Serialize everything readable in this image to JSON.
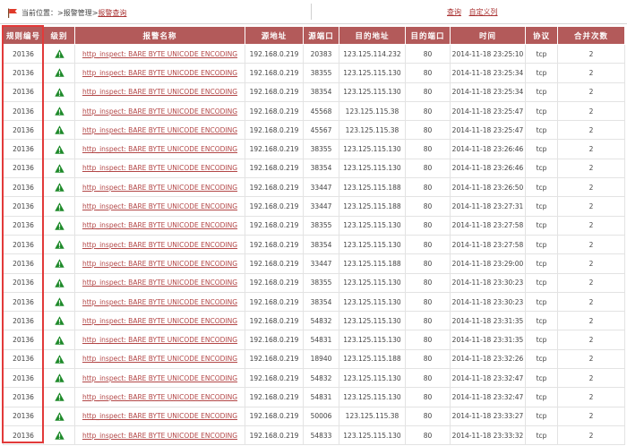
{
  "breadcrumb": {
    "prefix": "当前位置：",
    "sep1": ">",
    "level1": "报警管理",
    "sep2": ">",
    "level2": "报警查询"
  },
  "actions": {
    "query": "查询",
    "custom_columns": "自定义列"
  },
  "colors": {
    "header_bg": "#b35a5a",
    "link": "#b34747",
    "highlight_border": "#e23a3a",
    "warning_icon": "#1e8a2a"
  },
  "table": {
    "columns": [
      "规则编号",
      "级别",
      "报警名称",
      "源地址",
      "源端口",
      "目的地址",
      "目的端口",
      "时间",
      "协议",
      "合并次数"
    ],
    "rows": [
      {
        "rule_id": "20136",
        "level_icon": "warning-icon",
        "name": "http_inspect: BARE BYTE UNICODE ENCODING",
        "src": "192.168.0.219",
        "sport": "20383",
        "dst": "123.125.114.232",
        "dport": "80",
        "time": "2014-11-18 23:25:10",
        "proto": "tcp",
        "count": "2"
      },
      {
        "rule_id": "20136",
        "level_icon": "warning-icon",
        "name": "http_inspect: BARE BYTE UNICODE ENCODING",
        "src": "192.168.0.219",
        "sport": "38355",
        "dst": "123.125.115.130",
        "dport": "80",
        "time": "2014-11-18 23:25:34",
        "proto": "tcp",
        "count": "2"
      },
      {
        "rule_id": "20136",
        "level_icon": "warning-icon",
        "name": "http_inspect: BARE BYTE UNICODE ENCODING",
        "src": "192.168.0.219",
        "sport": "38354",
        "dst": "123.125.115.130",
        "dport": "80",
        "time": "2014-11-18 23:25:34",
        "proto": "tcp",
        "count": "2"
      },
      {
        "rule_id": "20136",
        "level_icon": "warning-icon",
        "name": "http_inspect: BARE BYTE UNICODE ENCODING",
        "src": "192.168.0.219",
        "sport": "45568",
        "dst": "123.125.115.38",
        "dport": "80",
        "time": "2014-11-18 23:25:47",
        "proto": "tcp",
        "count": "2"
      },
      {
        "rule_id": "20136",
        "level_icon": "warning-icon",
        "name": "http_inspect: BARE BYTE UNICODE ENCODING",
        "src": "192.168.0.219",
        "sport": "45567",
        "dst": "123.125.115.38",
        "dport": "80",
        "time": "2014-11-18 23:25:47",
        "proto": "tcp",
        "count": "2"
      },
      {
        "rule_id": "20136",
        "level_icon": "warning-icon",
        "name": "http_inspect: BARE BYTE UNICODE ENCODING",
        "src": "192.168.0.219",
        "sport": "38355",
        "dst": "123.125.115.130",
        "dport": "80",
        "time": "2014-11-18 23:26:46",
        "proto": "tcp",
        "count": "2"
      },
      {
        "rule_id": "20136",
        "level_icon": "warning-icon",
        "name": "http_inspect: BARE BYTE UNICODE ENCODING",
        "src": "192.168.0.219",
        "sport": "38354",
        "dst": "123.125.115.130",
        "dport": "80",
        "time": "2014-11-18 23:26:46",
        "proto": "tcp",
        "count": "2"
      },
      {
        "rule_id": "20136",
        "level_icon": "warning-icon",
        "name": "http_inspect: BARE BYTE UNICODE ENCODING",
        "src": "192.168.0.219",
        "sport": "33447",
        "dst": "123.125.115.188",
        "dport": "80",
        "time": "2014-11-18 23:26:50",
        "proto": "tcp",
        "count": "2"
      },
      {
        "rule_id": "20136",
        "level_icon": "warning-icon",
        "name": "http_inspect: BARE BYTE UNICODE ENCODING",
        "src": "192.168.0.219",
        "sport": "33447",
        "dst": "123.125.115.188",
        "dport": "80",
        "time": "2014-11-18 23:27:31",
        "proto": "tcp",
        "count": "2"
      },
      {
        "rule_id": "20136",
        "level_icon": "warning-icon",
        "name": "http_inspect: BARE BYTE UNICODE ENCODING",
        "src": "192.168.0.219",
        "sport": "38355",
        "dst": "123.125.115.130",
        "dport": "80",
        "time": "2014-11-18 23:27:58",
        "proto": "tcp",
        "count": "2"
      },
      {
        "rule_id": "20136",
        "level_icon": "warning-icon",
        "name": "http_inspect: BARE BYTE UNICODE ENCODING",
        "src": "192.168.0.219",
        "sport": "38354",
        "dst": "123.125.115.130",
        "dport": "80",
        "time": "2014-11-18 23:27:58",
        "proto": "tcp",
        "count": "2"
      },
      {
        "rule_id": "20136",
        "level_icon": "warning-icon",
        "name": "http_inspect: BARE BYTE UNICODE ENCODING",
        "src": "192.168.0.219",
        "sport": "33447",
        "dst": "123.125.115.188",
        "dport": "80",
        "time": "2014-11-18 23:29:00",
        "proto": "tcp",
        "count": "2"
      },
      {
        "rule_id": "20136",
        "level_icon": "warning-icon",
        "name": "http_inspect: BARE BYTE UNICODE ENCODING",
        "src": "192.168.0.219",
        "sport": "38355",
        "dst": "123.125.115.130",
        "dport": "80",
        "time": "2014-11-18 23:30:23",
        "proto": "tcp",
        "count": "2"
      },
      {
        "rule_id": "20136",
        "level_icon": "warning-icon",
        "name": "http_inspect: BARE BYTE UNICODE ENCODING",
        "src": "192.168.0.219",
        "sport": "38354",
        "dst": "123.125.115.130",
        "dport": "80",
        "time": "2014-11-18 23:30:23",
        "proto": "tcp",
        "count": "2"
      },
      {
        "rule_id": "20136",
        "level_icon": "warning-icon",
        "name": "http_inspect: BARE BYTE UNICODE ENCODING",
        "src": "192.168.0.219",
        "sport": "54832",
        "dst": "123.125.115.130",
        "dport": "80",
        "time": "2014-11-18 23:31:35",
        "proto": "tcp",
        "count": "2"
      },
      {
        "rule_id": "20136",
        "level_icon": "warning-icon",
        "name": "http_inspect: BARE BYTE UNICODE ENCODING",
        "src": "192.168.0.219",
        "sport": "54831",
        "dst": "123.125.115.130",
        "dport": "80",
        "time": "2014-11-18 23:31:35",
        "proto": "tcp",
        "count": "2"
      },
      {
        "rule_id": "20136",
        "level_icon": "warning-icon",
        "name": "http_inspect: BARE BYTE UNICODE ENCODING",
        "src": "192.168.0.219",
        "sport": "18940",
        "dst": "123.125.115.188",
        "dport": "80",
        "time": "2014-11-18 23:32:26",
        "proto": "tcp",
        "count": "2"
      },
      {
        "rule_id": "20136",
        "level_icon": "warning-icon",
        "name": "http_inspect: BARE BYTE UNICODE ENCODING",
        "src": "192.168.0.219",
        "sport": "54832",
        "dst": "123.125.115.130",
        "dport": "80",
        "time": "2014-11-18 23:32:47",
        "proto": "tcp",
        "count": "2"
      },
      {
        "rule_id": "20136",
        "level_icon": "warning-icon",
        "name": "http_inspect: BARE BYTE UNICODE ENCODING",
        "src": "192.168.0.219",
        "sport": "54831",
        "dst": "123.125.115.130",
        "dport": "80",
        "time": "2014-11-18 23:32:47",
        "proto": "tcp",
        "count": "2"
      },
      {
        "rule_id": "20136",
        "level_icon": "warning-icon",
        "name": "http_inspect: BARE BYTE UNICODE ENCODING",
        "src": "192.168.0.219",
        "sport": "50006",
        "dst": "123.125.115.38",
        "dport": "80",
        "time": "2014-11-18 23:33:27",
        "proto": "tcp",
        "count": "2"
      },
      {
        "rule_id": "20136",
        "level_icon": "warning-icon",
        "name": "http_inspect: BARE BYTE UNICODE ENCODING",
        "src": "192.168.0.219",
        "sport": "54833",
        "dst": "123.125.115.130",
        "dport": "80",
        "time": "2014-11-18 23:33:32",
        "proto": "tcp",
        "count": "2"
      }
    ]
  }
}
